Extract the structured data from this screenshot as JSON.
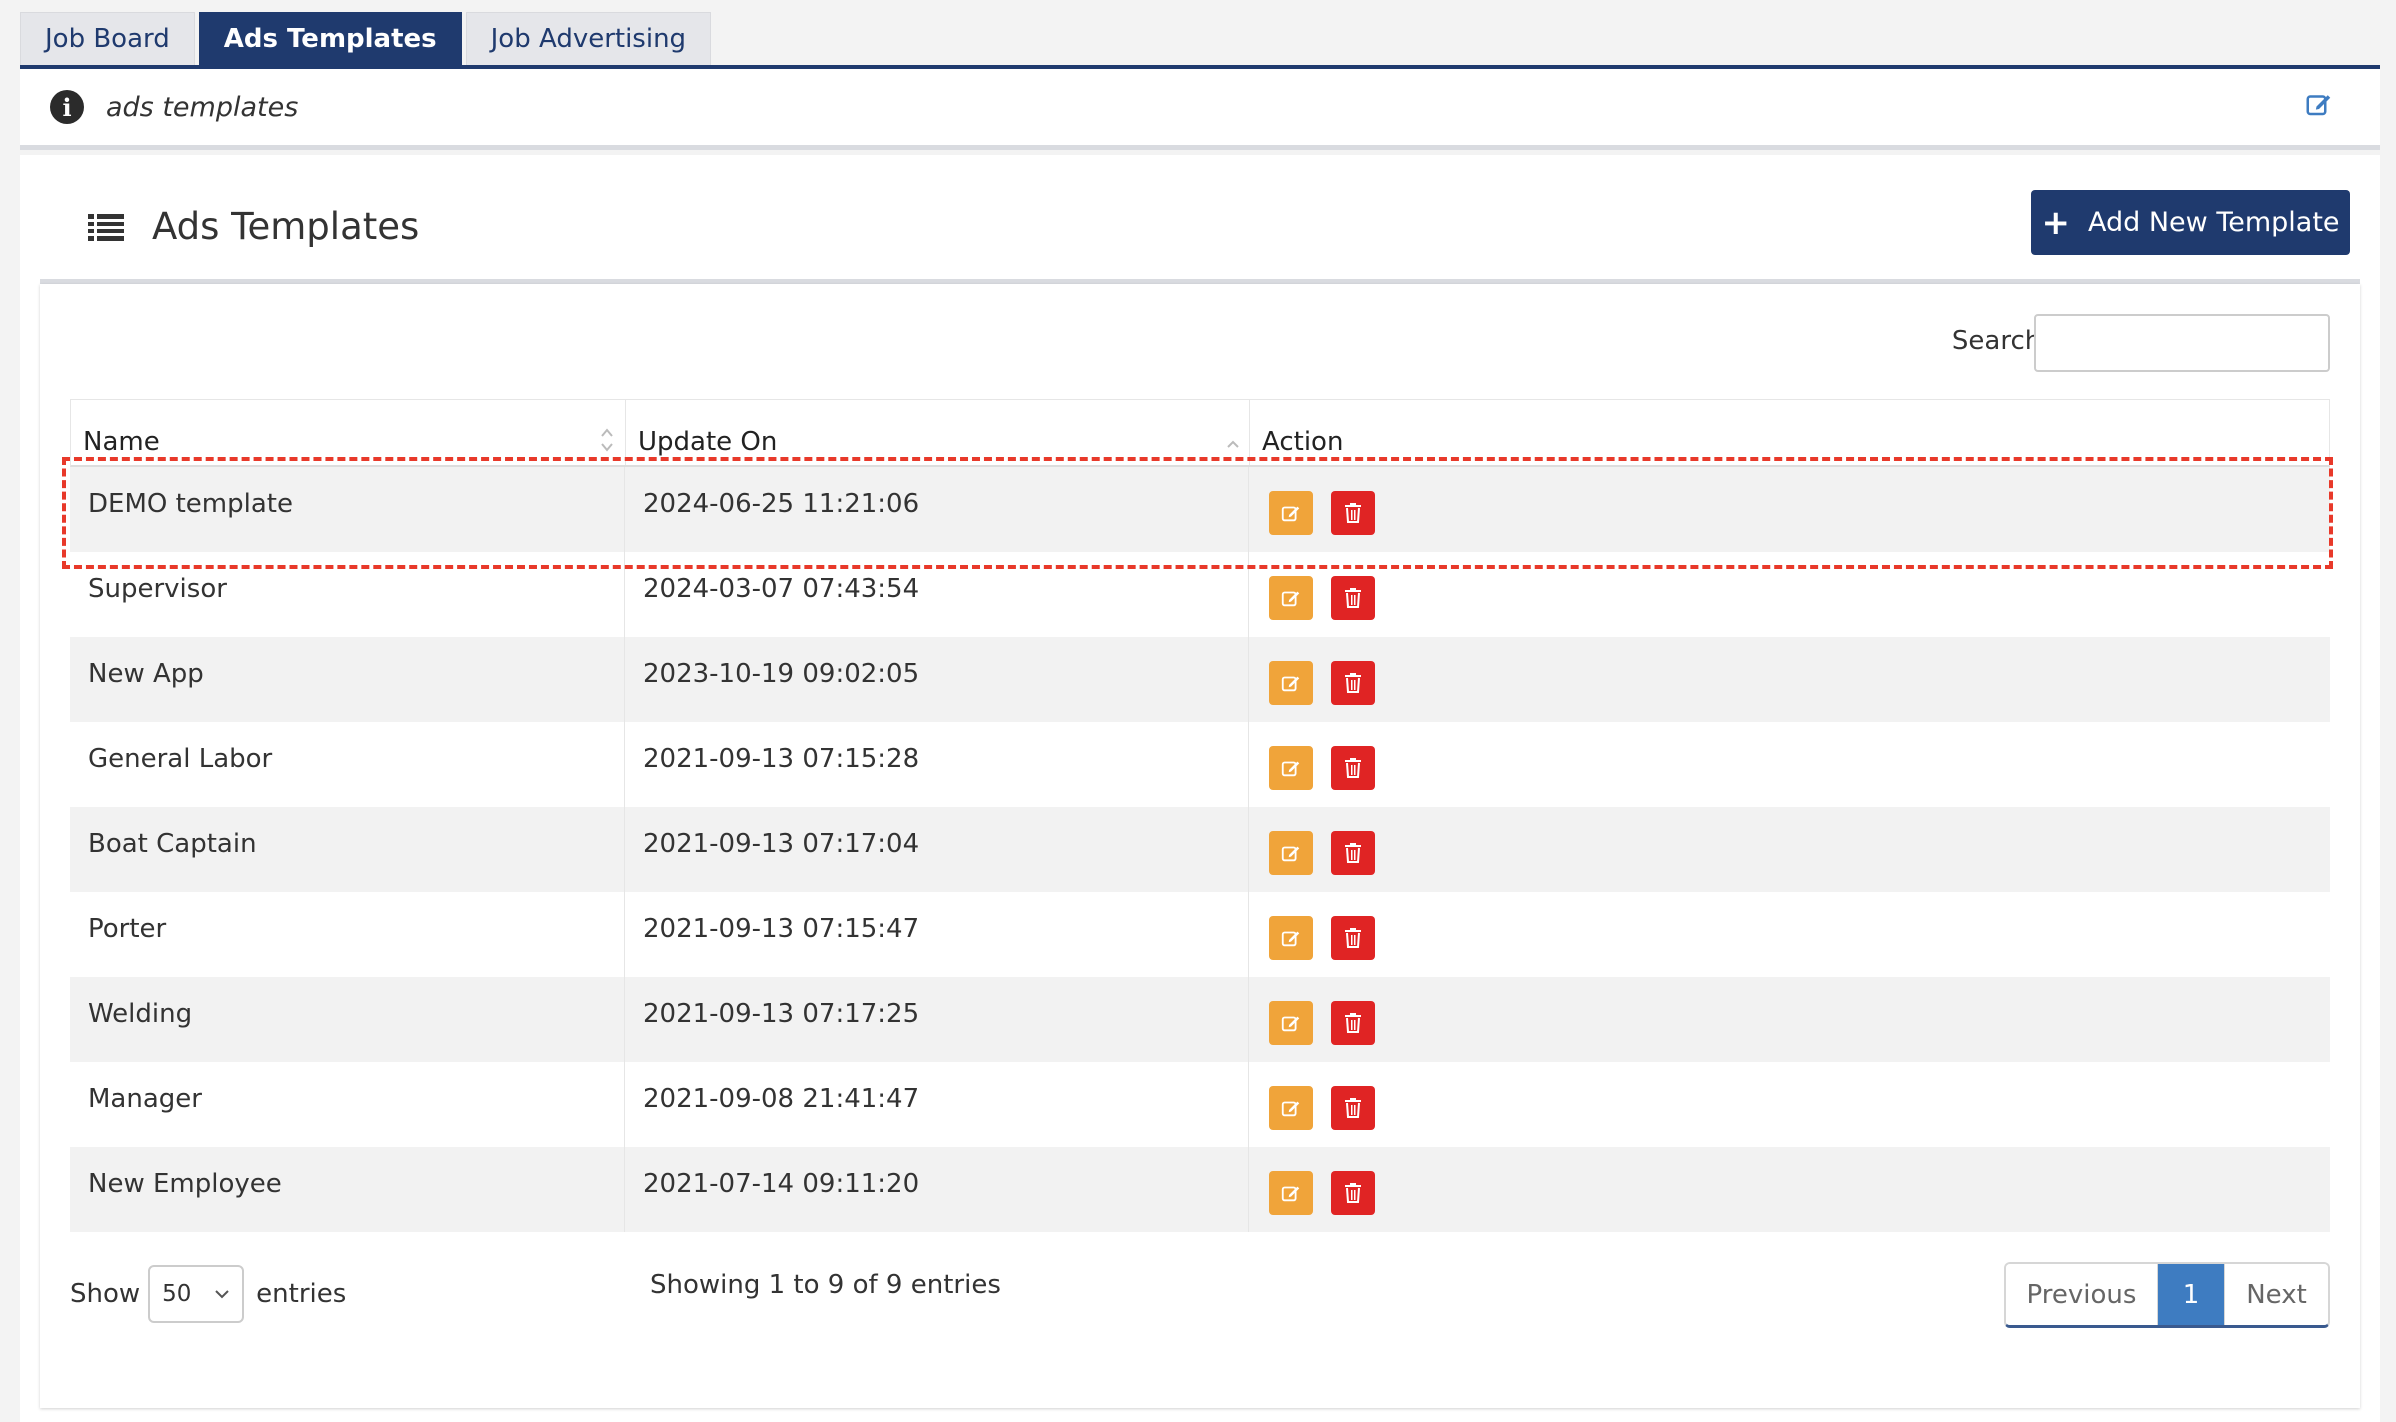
{
  "tabs": [
    {
      "label": "Job Board",
      "active": false
    },
    {
      "label": "Ads Templates",
      "active": true
    },
    {
      "label": "Job Advertising",
      "active": false
    }
  ],
  "info": {
    "text": "ads templates",
    "icon": "info-circle-icon",
    "edit_icon": "edit-icon"
  },
  "panel": {
    "title": "Ads Templates",
    "icon": "list-icon",
    "add_button": "Add New Template"
  },
  "search": {
    "label": "Search:",
    "value": ""
  },
  "table": {
    "headers": [
      "Name",
      "Update On",
      "Action"
    ],
    "rows": [
      {
        "name": "DEMO template",
        "updated": "2024-06-25 11:21:06",
        "highlighted": true
      },
      {
        "name": "Supervisor",
        "updated": "2024-03-07 07:43:54"
      },
      {
        "name": "New App",
        "updated": "2023-10-19 09:02:05"
      },
      {
        "name": "General Labor",
        "updated": "2021-09-13 07:15:28"
      },
      {
        "name": "Boat Captain",
        "updated": "2021-09-13 07:17:04"
      },
      {
        "name": "Porter",
        "updated": "2021-09-13 07:15:47"
      },
      {
        "name": "Welding",
        "updated": "2021-09-13 07:17:25"
      },
      {
        "name": "Manager",
        "updated": "2021-09-08 21:41:47"
      },
      {
        "name": "New Employee",
        "updated": "2021-07-14 09:11:20"
      }
    ]
  },
  "footer": {
    "show_label": "Show",
    "page_size": "50",
    "entries_label": "entries",
    "info": "Showing 1 to 9 of 9 entries",
    "prev": "Previous",
    "current_page": "1",
    "next": "Next"
  },
  "colors": {
    "primary": "#1f3a6e",
    "edit_button": "#f0a43a",
    "delete_button": "#e02424",
    "pager_active": "#3e7cc1",
    "highlight": "#e8392a"
  }
}
